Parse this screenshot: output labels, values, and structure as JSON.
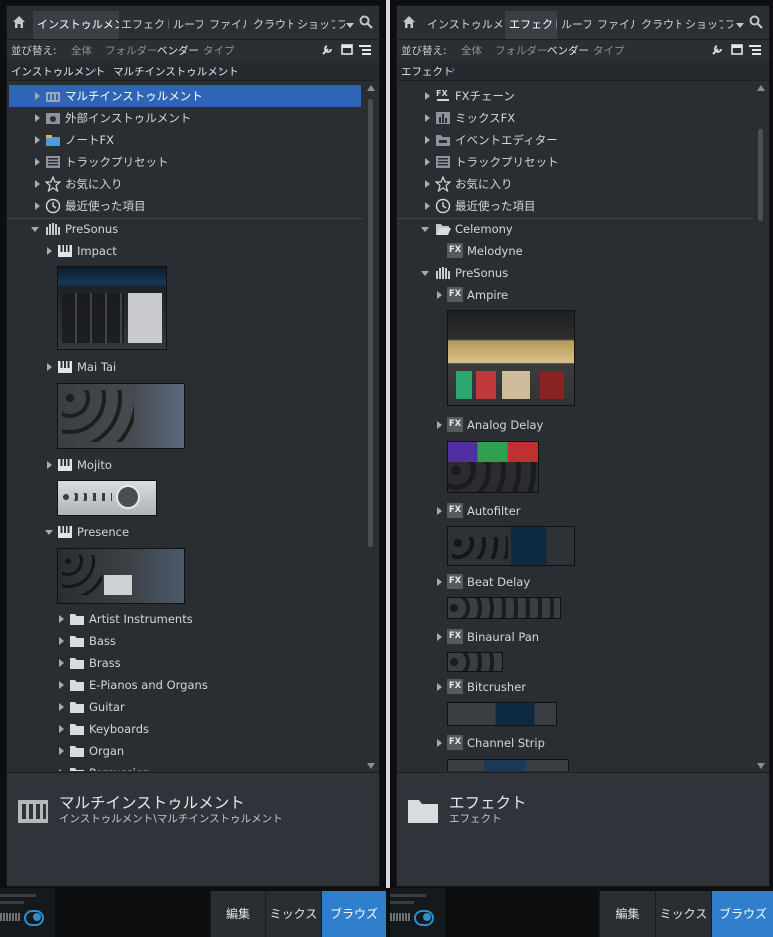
{
  "left": {
    "tabs": [
      "インストゥルメント",
      "エフェクト",
      "ループ",
      "ファイル",
      "クラウド",
      "ショップ",
      "フ"
    ],
    "selected_tab": 0,
    "sort": {
      "label": "並び替え:",
      "options": [
        "全体",
        "フォルダー",
        "ベンダー",
        "タイプ"
      ],
      "active": 2
    },
    "breadcrumb": [
      "インストゥルメント",
      "マルチインストゥルメント"
    ],
    "rows": {
      "r0": "マルチインストゥルメント",
      "r1": "外部インストゥルメント",
      "r2": "ノートFX",
      "r3": "トラックプリセット",
      "r4": "お気に入り",
      "r5": "最近使った項目",
      "r6": "PreSonus",
      "r7": "Impact",
      "r8": "Mai Tai",
      "r9": "Mojito",
      "r10": "Presence",
      "r11": "Artist Instruments",
      "r12": "Bass",
      "r13": "Brass",
      "r14": "E-Pianos and Organs",
      "r15": "Guitar",
      "r16": "Keyboards",
      "r17": "Organ",
      "r18": "Percussion"
    },
    "info": {
      "title": "マルチインストゥルメント",
      "path": "インストゥルメント\\マルチインストゥルメント"
    }
  },
  "right": {
    "tabs": [
      "インストゥルメント",
      "エフェクト",
      "ループ",
      "ファイル",
      "クラウド",
      "ショップ",
      "フ"
    ],
    "selected_tab": 1,
    "sort": {
      "label": "並び替え:",
      "options": [
        "全体",
        "フォルダー",
        "ベンダー",
        "タイプ"
      ],
      "active": 2
    },
    "breadcrumb": [
      "エフェクト"
    ],
    "rows": {
      "r0": "FXチェーン",
      "r1": "ミックスFX",
      "r2": "イベントエディター",
      "r3": "トラックプリセット",
      "r4": "お気に入り",
      "r5": "最近使った項目",
      "r6": "Celemony",
      "r7": "Melodyne",
      "r8": "PreSonus",
      "r9": "Ampire",
      "r10": "Analog Delay",
      "r11": "Autofilter",
      "r12": "Beat Delay",
      "r13": "Binaural Pan",
      "r14": "Bitcrusher",
      "r15": "Channel Strip"
    },
    "fx_badge": "FX",
    "info": {
      "title": "エフェクト",
      "path": "エフェクト"
    }
  },
  "bottom": {
    "buttons": [
      "編集",
      "ミックス",
      "ブラウズ"
    ],
    "active": 2
  },
  "colors": {
    "accent": "#2f7fcc",
    "selection": "#2f65b6",
    "panel": "#2a2d32"
  }
}
